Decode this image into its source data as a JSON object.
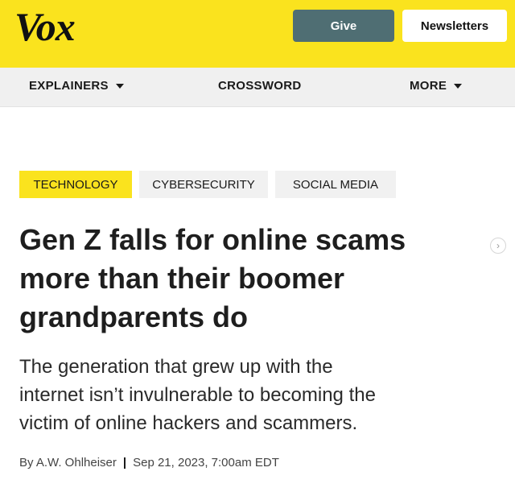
{
  "header": {
    "logo": "Vox",
    "give_label": "Give",
    "newsletters_label": "Newsletters"
  },
  "nav": {
    "explainers": "EXPLAINERS",
    "crossword": "CROSSWORD",
    "more": "MORE"
  },
  "tags": [
    "TECHNOLOGY",
    "CYBERSECURITY",
    "SOCIAL MEDIA"
  ],
  "article": {
    "headline_lines": [
      "Gen Z falls for online scams",
      "more than their boomer",
      "grandparents do"
    ],
    "dek_lines": [
      "The generation that grew up with the",
      "internet isn’t invulnerable to becoming the",
      "victim of online hackers and scammers."
    ],
    "author": "By A.W. Ohlheiser",
    "separator": "|",
    "date": "Sep 21, 2023, 7:00am EDT"
  },
  "colors": {
    "brand_yellow": "#fae31e",
    "give_button": "#4f6e73",
    "nav_bg": "#f0f0f0"
  },
  "icons": {
    "nav_caret": "chevron-down-icon",
    "next": "chevron-right-icon"
  }
}
